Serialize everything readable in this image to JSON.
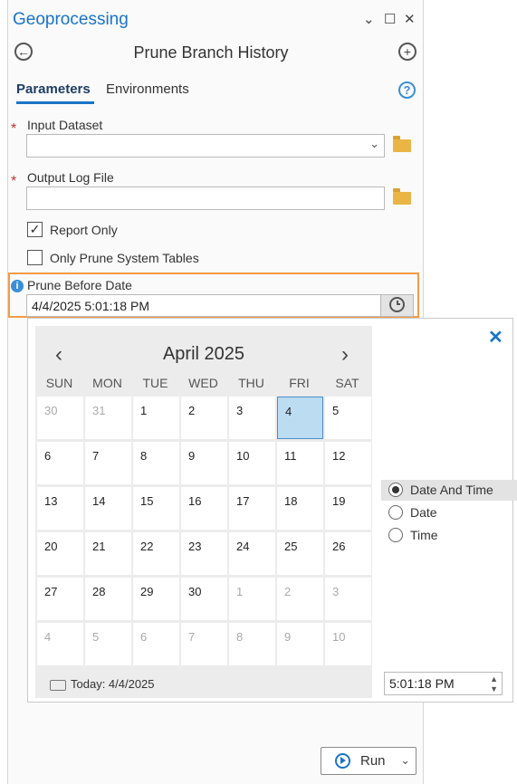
{
  "pane": {
    "title": "Geoprocessing",
    "window_buttons": [
      "⌄",
      "☐",
      "✕"
    ]
  },
  "tool": {
    "title": "Prune Branch History",
    "back_glyph": "←",
    "add_glyph": "+"
  },
  "tabs": [
    {
      "label": "Parameters",
      "active": true
    },
    {
      "label": "Environments",
      "active": false
    }
  ],
  "help_glyph": "?",
  "params": {
    "input_dataset": {
      "label": "Input Dataset",
      "value": "",
      "required": true
    },
    "output_log_file": {
      "label": "Output Log File",
      "value": "",
      "required": true
    },
    "report_only": {
      "label": "Report Only",
      "checked": true
    },
    "only_prune_system_tables": {
      "label": "Only Prune System Tables",
      "checked": false
    },
    "prune_before_date": {
      "label": "Prune Before Date",
      "value": "4/4/2025 5:01:18 PM"
    }
  },
  "calendar": {
    "month_label": "April 2025",
    "prev_glyph": "‹",
    "next_glyph": "›",
    "weekdays": [
      "SUN",
      "MON",
      "TUE",
      "WED",
      "THU",
      "FRI",
      "SAT"
    ],
    "weeks": [
      [
        "30",
        "31",
        "1",
        "2",
        "3",
        "4",
        "5"
      ],
      [
        "6",
        "7",
        "8",
        "9",
        "10",
        "11",
        "12"
      ],
      [
        "13",
        "14",
        "15",
        "16",
        "17",
        "18",
        "19"
      ],
      [
        "20",
        "21",
        "22",
        "23",
        "24",
        "25",
        "26"
      ],
      [
        "27",
        "28",
        "29",
        "30",
        "1",
        "2",
        "3"
      ],
      [
        "4",
        "5",
        "6",
        "7",
        "8",
        "9",
        "10"
      ]
    ],
    "selected_day": "4",
    "today_label": "Today: 4/4/2025"
  },
  "mode_options": [
    {
      "label": "Date And Time",
      "checked": true
    },
    {
      "label": "Date",
      "checked": false
    },
    {
      "label": "Time",
      "checked": false
    }
  ],
  "time_value": "5:01:18 PM",
  "close_glyph": "✕",
  "run_label": "Run",
  "colors": {
    "accent": "#1a74c7",
    "highlight_border": "#f39c47",
    "required": "#c0392b",
    "selected_day_bg": "#bcdcf2"
  }
}
